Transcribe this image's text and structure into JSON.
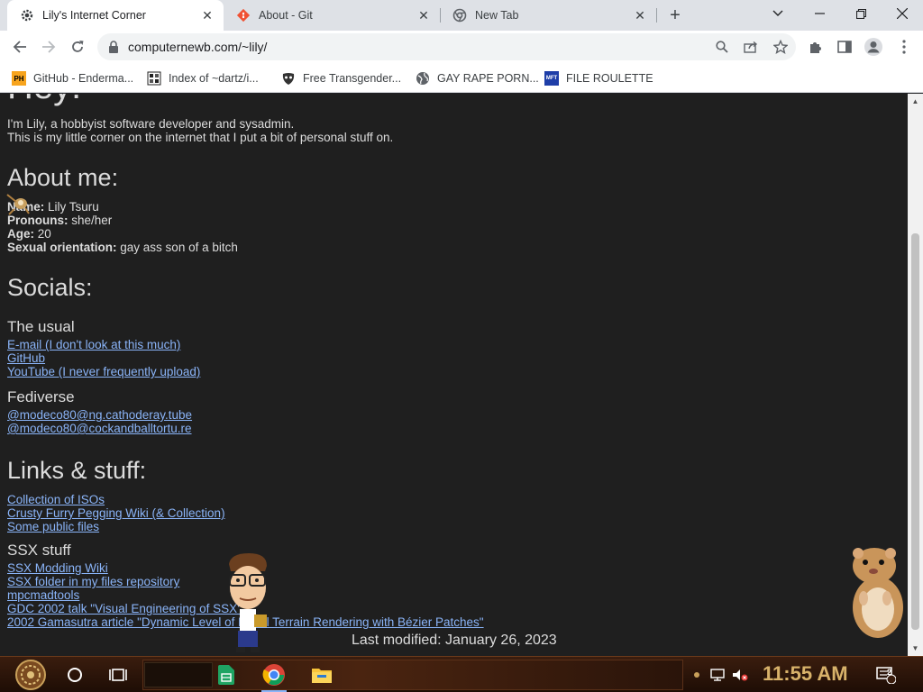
{
  "browser": {
    "tabs": [
      {
        "title": "Lily's Internet Corner",
        "active": true,
        "favicon": "gear-favicon"
      },
      {
        "title": "About - Git",
        "active": false,
        "favicon": "git-favicon"
      },
      {
        "title": "New Tab",
        "active": false,
        "favicon": "chrome-favicon"
      }
    ],
    "address": "computernewb.com/~lily/",
    "bookmarks": [
      {
        "label": "GitHub - Enderma...",
        "icon": "ph-icon"
      },
      {
        "label": "Index of ~dartz/i...",
        "icon": "index-icon"
      },
      {
        "label": "Free Transgender...",
        "icon": "mask-icon"
      },
      {
        "label": "GAY RAPE PORN...",
        "icon": "globe-icon"
      },
      {
        "label": "FILE ROULETTE",
        "icon": "mft-icon"
      }
    ]
  },
  "page": {
    "heading": "Hey!",
    "intro": [
      "I'm Lily, a hobbyist software developer and sysadmin.",
      "This is my little corner on the internet that I put a bit of personal stuff on."
    ],
    "about": {
      "heading": "About me:",
      "items": [
        {
          "label": "Name:",
          "value": " Lily Tsuru"
        },
        {
          "label": "Pronouns:",
          "value": " she/her"
        },
        {
          "label": "Age:",
          "value": " 20"
        },
        {
          "label": "Sexual orientation:",
          "value": " gay ass son of a bitch"
        }
      ]
    },
    "socials": {
      "heading": "Socials:",
      "usual_heading": "The usual",
      "usual_links": [
        "E-mail (I don't look at this much)",
        "GitHub",
        "YouTube (I never frequently upload)"
      ],
      "fediverse_heading": "Fediverse",
      "fediverse_links": [
        "@modeco80@ng.cathoderay.tube",
        "@modeco80@cockandballtortu.re"
      ]
    },
    "links": {
      "heading": "Links & stuff:",
      "items": [
        "Collection of ISOs",
        "Crusty Furry Pegging Wiki (& Collection)",
        "Some public files"
      ],
      "ssx_heading": "SSX stuff",
      "ssx_items": [
        "SSX Modding Wiki",
        "SSX folder in my files repository",
        "mpcmadtools",
        "GDC 2002 talk \"Visual Engineering of SSX\"",
        "2002 Gamasutra article \"Dynamic Level of Detail Terrain Rendering with Bézier Patches\""
      ]
    },
    "footer": "Last modified: January 26, 2023"
  },
  "taskbar": {
    "clock": "11:55 AM",
    "notification_count": "2"
  },
  "colors": {
    "page_bg": "#1f1f1f",
    "text": "#dcdcdc",
    "link": "#8ab4f8"
  }
}
